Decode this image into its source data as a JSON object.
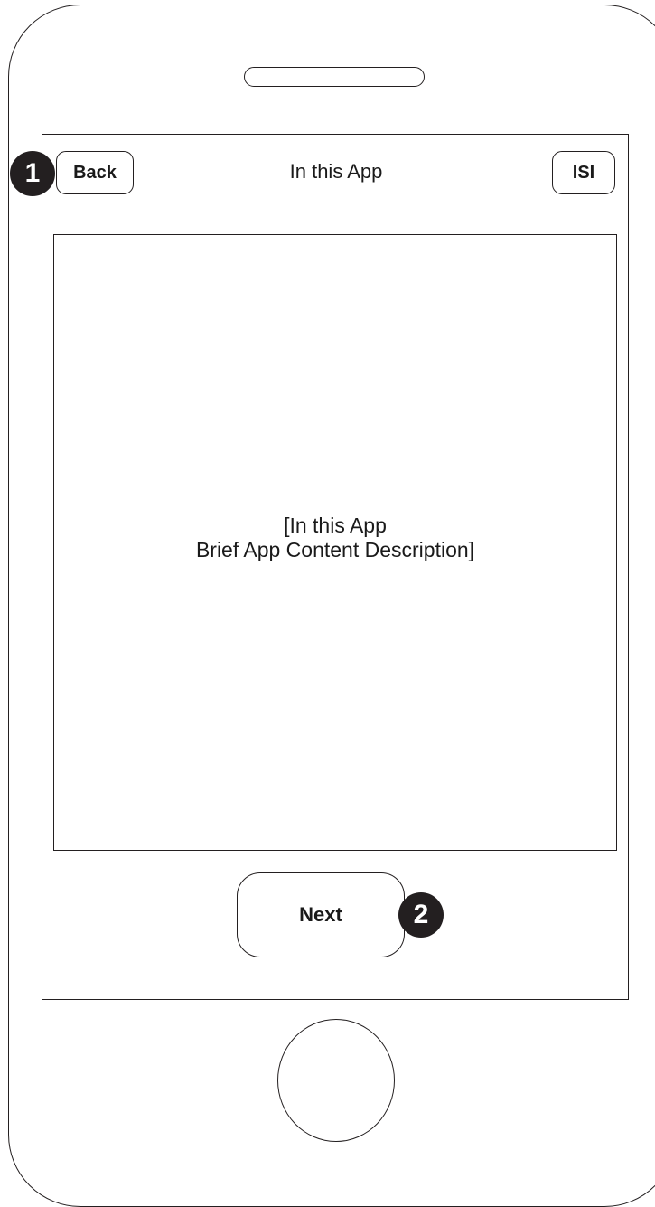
{
  "nav": {
    "back_label": "Back",
    "title": "In this App",
    "isi_label": "ISI"
  },
  "content": {
    "line1": "[In this App",
    "line2": "Brief App Content Description]"
  },
  "footer": {
    "next_label": "Next"
  },
  "callouts": {
    "one": "1",
    "two": "2"
  },
  "icons": {
    "speaker": "speaker-slot-icon",
    "home": "home-button-icon"
  },
  "colors": {
    "outline": "#231f20",
    "callout_fill": "#231f20",
    "callout_text": "#ffffff",
    "background": "#ffffff"
  }
}
